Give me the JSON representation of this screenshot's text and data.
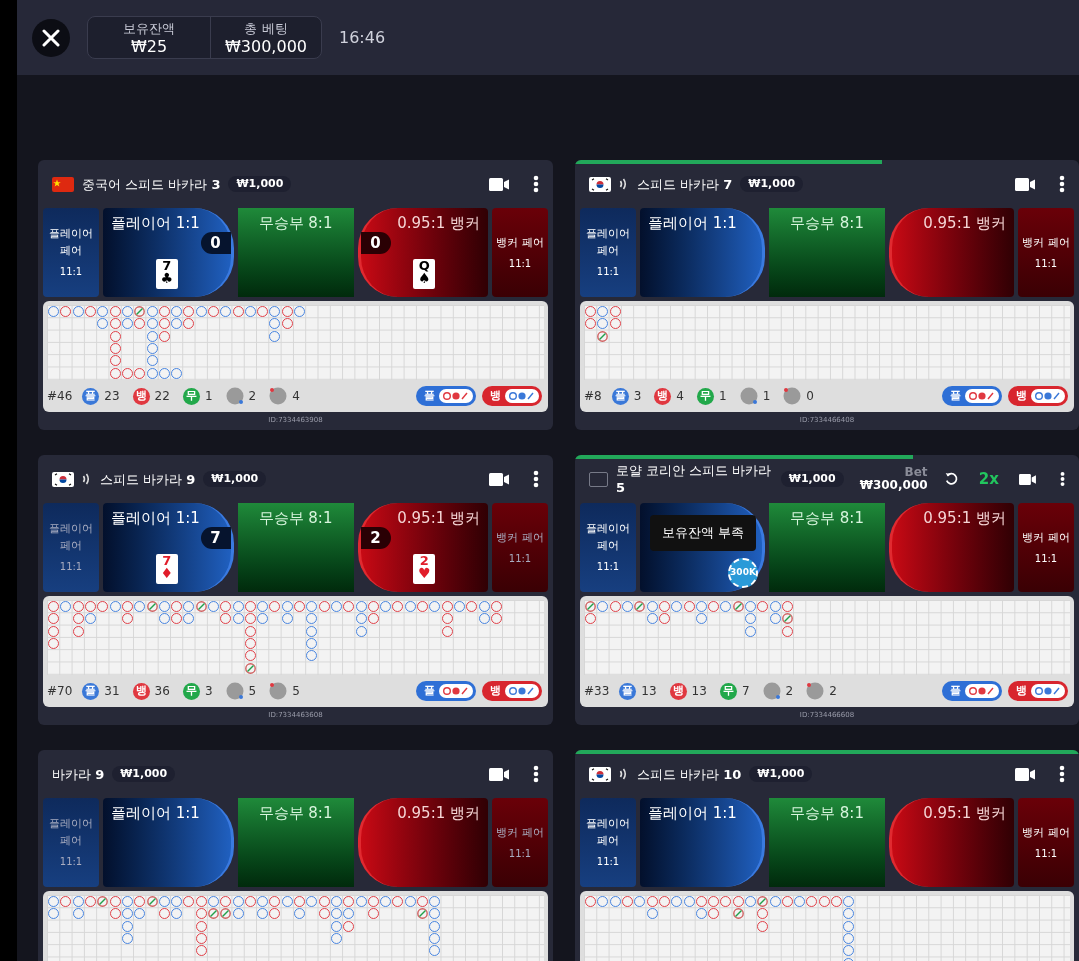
{
  "topbar": {
    "balance": {
      "label": "보유잔액",
      "value": "₩25"
    },
    "total_bet": {
      "label": "총 베팅",
      "value": "₩300,000"
    },
    "time": "16:46"
  },
  "table_rows": [
    [
      {
        "flag": {
          "kind": "china"
        },
        "audio": false,
        "title": "중국어 스피드 바카라 **3**",
        "min_bet": "₩1,000",
        "bets": {
          "player_pair": {
            "label": "플레이어 페어",
            "odds": "11:1",
            "dimmed": false
          },
          "player": {
            "label": "플레이어 1:1",
            "score": "0",
            "card": {
              "rank": "7",
              "suit": "♣",
              "color": "#000000"
            }
          },
          "tie": {
            "label": "무승부 8:1"
          },
          "banker": {
            "label": "0.95:1 뱅커",
            "score": "0",
            "card": {
              "rank": "Q",
              "suit": "♠",
              "color": "#000000"
            }
          },
          "banker_pair": {
            "label": "뱅커 페어",
            "odds": "11:1",
            "dimmed": false
          }
        },
        "road": [
          [
            {
              "kind": "p"
            }
          ],
          [
            {
              "kind": "b"
            }
          ],
          [
            {
              "kind": "p"
            }
          ],
          [
            {
              "kind": "b"
            }
          ],
          [
            {
              "kind": "p"
            },
            {
              "kind": "p"
            }
          ],
          [
            {
              "kind": "b"
            },
            {
              "kind": "b"
            },
            {
              "kind": "b"
            },
            {
              "kind": "b"
            },
            {
              "kind": "b"
            },
            {
              "kind": "b"
            }
          ],
          [
            {
              "kind": "p"
            },
            {
              "kind": "p"
            },
            {
              "kind": "gap"
            },
            {
              "kind": "gap"
            },
            {
              "kind": "gap"
            },
            {
              "kind": "b"
            }
          ],
          [
            {
              "kind": "t"
            },
            {
              "kind": "b"
            },
            {
              "kind": "gap"
            },
            {
              "kind": "gap"
            },
            {
              "kind": "gap"
            },
            {
              "kind": "b"
            }
          ],
          [
            {
              "kind": "p"
            },
            {
              "kind": "p"
            },
            {
              "kind": "p"
            },
            {
              "kind": "p"
            },
            {
              "kind": "p"
            },
            {
              "kind": "p"
            }
          ],
          [
            {
              "kind": "b"
            },
            {
              "kind": "b"
            },
            {
              "kind": "b"
            },
            {
              "kind": "gap"
            },
            {
              "kind": "gap"
            },
            {
              "kind": "p"
            }
          ],
          [
            {
              "kind": "p"
            },
            {
              "kind": "p"
            },
            {
              "kind": "gap"
            },
            {
              "kind": "gap"
            },
            {
              "kind": "gap"
            },
            {
              "kind": "p"
            }
          ],
          [
            {
              "kind": "b"
            },
            {
              "kind": "b"
            }
          ],
          [
            {
              "kind": "p"
            }
          ],
          [
            {
              "kind": "b"
            }
          ],
          [
            {
              "kind": "p"
            }
          ],
          [
            {
              "kind": "b"
            }
          ],
          [
            {
              "kind": "p"
            }
          ],
          [
            {
              "kind": "b"
            }
          ],
          [
            {
              "kind": "p"
            },
            {
              "kind": "p"
            },
            {
              "kind": "p"
            }
          ],
          [
            {
              "kind": "b"
            },
            {
              "kind": "b"
            }
          ],
          [
            {
              "kind": "p"
            }
          ]
        ],
        "stats": {
          "round": "#46",
          "items": [
            {
              "kind": "player",
              "badge": "플",
              "count": "23"
            },
            {
              "kind": "banker",
              "badge": "뱅",
              "count": "22"
            },
            {
              "kind": "tie",
              "badge": "무",
              "count": "1"
            },
            {
              "kind": "player_pair",
              "count": "2"
            },
            {
              "kind": "banker_pair",
              "count": "4"
            }
          ]
        },
        "toggles": [
          {
            "kind": "player",
            "label": "플"
          },
          {
            "kind": "banker",
            "label": "뱅"
          }
        ],
        "id": "ID:7334463908"
      },
      {
        "flag": {
          "kind": "korea"
        },
        "audio": true,
        "timer": {
          "level": 0.61
        },
        "title": "스피드 바카라 **7**",
        "min_bet": "₩1,000",
        "bets": {
          "player_pair": {
            "label": "플레이어 페어",
            "odds": "11:1",
            "dimmed": false
          },
          "player": {
            "label": "플레이어 1:1"
          },
          "tie": {
            "label": "무승부 8:1"
          },
          "banker": {
            "label": "0.95:1 뱅커"
          },
          "banker_pair": {
            "label": "뱅커 페어",
            "odds": "11:1",
            "dimmed": false
          }
        },
        "road": [
          [
            {
              "kind": "b"
            },
            {
              "kind": "b"
            }
          ],
          [
            {
              "kind": "p"
            },
            {
              "kind": "p"
            },
            {
              "kind": "t"
            }
          ],
          [
            {
              "kind": "b"
            },
            {
              "kind": "b"
            }
          ]
        ],
        "stats": {
          "round": "#8",
          "items": [
            {
              "kind": "player",
              "badge": "플",
              "count": "3"
            },
            {
              "kind": "banker",
              "badge": "뱅",
              "count": "4"
            },
            {
              "kind": "tie",
              "badge": "무",
              "count": "1"
            },
            {
              "kind": "player_pair",
              "count": "1"
            },
            {
              "kind": "banker_pair",
              "count": "0"
            }
          ]
        },
        "toggles": [
          {
            "kind": "player",
            "label": "플"
          },
          {
            "kind": "banker",
            "label": "뱅"
          }
        ],
        "id": "ID:7334466408"
      }
    ],
    [
      {
        "flag": {
          "kind": "korea"
        },
        "audio": true,
        "title": "스피드 바카라 **9**",
        "min_bet": "₩1,000",
        "bets": {
          "player_pair": {
            "label": "플레이어 페어",
            "odds": "11:1",
            "dimmed": true
          },
          "player": {
            "label": "플레이어 1:1",
            "score": "7",
            "card": {
              "rank": "7",
              "suit": "♦",
              "color": "#e11d2a"
            }
          },
          "tie": {
            "label": "무승부 8:1"
          },
          "banker": {
            "label": "0.95:1 뱅커",
            "score": "2",
            "card": {
              "rank": "2",
              "suit": "♥",
              "color": "#e11d2a"
            }
          },
          "banker_pair": {
            "label": "뱅커 페어",
            "odds": "11:1",
            "dimmed": true
          }
        },
        "road": [
          [
            {
              "kind": "b"
            },
            {
              "kind": "b"
            },
            {
              "kind": "b"
            },
            {
              "kind": "b"
            }
          ],
          [
            {
              "kind": "p"
            }
          ],
          [
            {
              "kind": "b"
            },
            {
              "kind": "b"
            },
            {
              "kind": "b"
            }
          ],
          [
            {
              "kind": "b"
            },
            {
              "kind": "p"
            }
          ],
          [
            {
              "kind": "b"
            }
          ],
          [
            {
              "kind": "p"
            }
          ],
          [
            {
              "kind": "b"
            },
            {
              "kind": "b"
            }
          ],
          [
            {
              "kind": "p"
            }
          ],
          [
            {
              "kind": "t"
            }
          ],
          [
            {
              "kind": "p"
            },
            {
              "kind": "p"
            }
          ],
          [
            {
              "kind": "b"
            },
            {
              "kind": "b"
            }
          ],
          [
            {
              "kind": "p"
            },
            {
              "kind": "p"
            }
          ],
          [
            {
              "kind": "t"
            }
          ],
          [
            {
              "kind": "p"
            }
          ],
          [
            {
              "kind": "b"
            },
            {
              "kind": "b"
            }
          ],
          [
            {
              "kind": "p"
            },
            {
              "kind": "p"
            }
          ],
          [
            {
              "kind": "b"
            },
            {
              "kind": "b"
            },
            {
              "kind": "b"
            },
            {
              "kind": "b"
            },
            {
              "kind": "b"
            },
            {
              "kind": "t"
            }
          ],
          [
            {
              "kind": "p"
            },
            {
              "kind": "p"
            }
          ],
          [
            {
              "kind": "b"
            }
          ],
          [
            {
              "kind": "p"
            },
            {
              "kind": "p"
            }
          ],
          [
            {
              "kind": "b"
            }
          ],
          [
            {
              "kind": "p"
            },
            {
              "kind": "p"
            },
            {
              "kind": "p"
            },
            {
              "kind": "p"
            },
            {
              "kind": "p"
            }
          ],
          [
            {
              "kind": "b"
            }
          ],
          [
            {
              "kind": "p"
            }
          ],
          [
            {
              "kind": "b"
            }
          ],
          [
            {
              "kind": "p"
            },
            {
              "kind": "p"
            },
            {
              "kind": "p"
            }
          ],
          [
            {
              "kind": "b"
            },
            {
              "kind": "b"
            }
          ],
          [
            {
              "kind": "p"
            }
          ],
          [
            {
              "kind": "b"
            }
          ],
          [
            {
              "kind": "p"
            }
          ],
          [
            {
              "kind": "b"
            }
          ],
          [
            {
              "kind": "p"
            }
          ],
          [
            {
              "kind": "b"
            },
            {
              "kind": "b"
            },
            {
              "kind": "b"
            }
          ],
          [
            {
              "kind": "p"
            }
          ],
          [
            {
              "kind": "b"
            }
          ],
          [
            {
              "kind": "p"
            },
            {
              "kind": "p"
            }
          ],
          [
            {
              "kind": "b"
            },
            {
              "kind": "b"
            }
          ]
        ],
        "stats": {
          "round": "#70",
          "items": [
            {
              "kind": "player",
              "badge": "플",
              "count": "31"
            },
            {
              "kind": "banker",
              "badge": "뱅",
              "count": "36"
            },
            {
              "kind": "tie",
              "badge": "무",
              "count": "3"
            },
            {
              "kind": "player_pair",
              "count": "5"
            },
            {
              "kind": "banker_pair",
              "count": "5"
            }
          ]
        },
        "toggles": [
          {
            "kind": "player",
            "label": "플"
          },
          {
            "kind": "banker",
            "label": "뱅"
          }
        ],
        "id": "ID:7334463608"
      },
      {
        "flag": {
          "kind": "blank"
        },
        "audio": false,
        "timer": {
          "level": 0.67
        },
        "title": "로얄 코리안 스피드 바카라 **5**",
        "min_bet": "₩1,000",
        "bet": {
          "label": "Bet",
          "amount": "₩300,000"
        },
        "multiplier": "2x",
        "bets": {
          "player_pair": {
            "label": "플레이어 페어",
            "odds": "11:1",
            "dimmed": false
          },
          "player": {
            "tooltip": "보유잔액 부족",
            "chip": "300K"
          },
          "tie": {
            "label": "무승부 8:1"
          },
          "banker": {
            "label": "0.95:1 뱅커"
          },
          "banker_pair": {
            "label": "뱅커 페어",
            "odds": "11:1",
            "dimmed": false
          }
        },
        "road": [
          [
            {
              "kind": "t"
            },
            {
              "kind": "b"
            }
          ],
          [
            {
              "kind": "p"
            }
          ],
          [
            {
              "kind": "b"
            }
          ],
          [
            {
              "kind": "p"
            }
          ],
          [
            {
              "kind": "t"
            }
          ],
          [
            {
              "kind": "p"
            },
            {
              "kind": "p"
            }
          ],
          [
            {
              "kind": "b"
            },
            {
              "kind": "b"
            }
          ],
          [
            {
              "kind": "p"
            }
          ],
          [
            {
              "kind": "b"
            }
          ],
          [
            {
              "kind": "p"
            },
            {
              "kind": "p"
            }
          ],
          [
            {
              "kind": "b"
            }
          ],
          [
            {
              "kind": "p"
            }
          ],
          [
            {
              "kind": "t"
            }
          ],
          [
            {
              "kind": "p"
            },
            {
              "kind": "p"
            },
            {
              "kind": "p"
            }
          ],
          [
            {
              "kind": "b"
            }
          ],
          [
            {
              "kind": "p"
            },
            {
              "kind": "p"
            }
          ],
          [
            {
              "kind": "b"
            },
            {
              "kind": "t"
            },
            {
              "kind": "b"
            }
          ]
        ],
        "stats": {
          "round": "#33",
          "items": [
            {
              "kind": "player",
              "badge": "플",
              "count": "13"
            },
            {
              "kind": "banker",
              "badge": "뱅",
              "count": "13"
            },
            {
              "kind": "tie",
              "badge": "무",
              "count": "7"
            },
            {
              "kind": "player_pair",
              "count": "2"
            },
            {
              "kind": "banker_pair",
              "count": "2"
            }
          ]
        },
        "toggles": [
          {
            "kind": "player",
            "label": "플"
          },
          {
            "kind": "banker",
            "label": "뱅"
          }
        ],
        "id": "ID:7334466608"
      }
    ],
    [
      {
        "audio": false,
        "title": "바카라 **9**",
        "min_bet": "₩1,000",
        "bets": {
          "player_pair": {
            "label": "플레이어 페어",
            "odds": "11:1",
            "dimmed": true
          },
          "player": {
            "label": "플레이어 1:1"
          },
          "tie": {
            "label": "무승부 8:1"
          },
          "banker": {
            "label": "0.95:1 뱅커"
          },
          "banker_pair": {
            "label": "뱅커 페어",
            "odds": "11:1",
            "dimmed": true
          }
        },
        "road": [
          [
            {
              "kind": "p"
            },
            {
              "kind": "p"
            }
          ],
          [
            {
              "kind": "b"
            }
          ],
          [
            {
              "kind": "p"
            },
            {
              "kind": "p"
            }
          ],
          [
            {
              "kind": "b"
            }
          ],
          [
            {
              "kind": "t"
            }
          ],
          [
            {
              "kind": "b"
            },
            {
              "kind": "b"
            }
          ],
          [
            {
              "kind": "p"
            },
            {
              "kind": "p"
            },
            {
              "kind": "p"
            },
            {
              "kind": "p"
            }
          ],
          [
            {
              "kind": "b"
            },
            {
              "kind": "p"
            }
          ],
          [
            {
              "kind": "t"
            }
          ],
          [
            {
              "kind": "p"
            },
            {
              "kind": "b"
            }
          ],
          [
            {
              "kind": "p"
            },
            {
              "kind": "p"
            }
          ],
          [
            {
              "kind": "b"
            }
          ],
          [
            {
              "kind": "b"
            },
            {
              "kind": "b"
            },
            {
              "kind": "b"
            },
            {
              "kind": "b"
            },
            {
              "kind": "b"
            }
          ],
          [
            {
              "kind": "p"
            },
            {
              "kind": "t"
            }
          ],
          [
            {
              "kind": "b"
            },
            {
              "kind": "t"
            }
          ],
          [
            {
              "kind": "p"
            },
            {
              "kind": "p"
            }
          ],
          [
            {
              "kind": "b"
            }
          ],
          [
            {
              "kind": "p"
            },
            {
              "kind": "p"
            }
          ],
          [
            {
              "kind": "b"
            },
            {
              "kind": "b"
            }
          ],
          [
            {
              "kind": "p"
            }
          ],
          [
            {
              "kind": "b"
            },
            {
              "kind": "p"
            }
          ],
          [
            {
              "kind": "p"
            }
          ],
          [
            {
              "kind": "b"
            },
            {
              "kind": "b"
            }
          ],
          [
            {
              "kind": "p"
            },
            {
              "kind": "p"
            },
            {
              "kind": "p"
            },
            {
              "kind": "p"
            }
          ],
          [
            {
              "kind": "b"
            },
            {
              "kind": "p"
            },
            {
              "kind": "b"
            }
          ],
          [
            {
              "kind": "p"
            }
          ],
          [
            {
              "kind": "b"
            },
            {
              "kind": "b"
            }
          ],
          [
            {
              "kind": "p"
            }
          ],
          [
            {
              "kind": "b"
            }
          ],
          [
            {
              "kind": "p"
            }
          ],
          [
            {
              "kind": "b"
            },
            {
              "kind": "t"
            }
          ],
          [
            {
              "kind": "p"
            },
            {
              "kind": "p"
            },
            {
              "kind": "p"
            },
            {
              "kind": "p"
            },
            {
              "kind": "p"
            }
          ]
        ]
      },
      {
        "flag": {
          "kind": "korea"
        },
        "audio": true,
        "timer": {
          "level": 1
        },
        "title": "스피드 바카라 **10**",
        "min_bet": "₩1,000",
        "bets": {
          "player_pair": {
            "label": "플레이어 페어",
            "odds": "11:1",
            "dimmed": false
          },
          "player": {
            "label": "플레이어 1:1"
          },
          "tie": {
            "label": "무승부 8:1"
          },
          "banker": {
            "label": "0.95:1 뱅커"
          },
          "banker_pair": {
            "label": "뱅커 페어",
            "odds": "11:1",
            "dimmed": false
          }
        },
        "road": [
          [
            {
              "kind": "b"
            }
          ],
          [
            {
              "kind": "p"
            }
          ],
          [
            {
              "kind": "p"
            }
          ],
          [
            {
              "kind": "b"
            }
          ],
          [
            {
              "kind": "p"
            }
          ],
          [
            {
              "kind": "b"
            },
            {
              "kind": "p"
            }
          ],
          [
            {
              "kind": "b"
            }
          ],
          [
            {
              "kind": "p"
            }
          ],
          [
            {
              "kind": "p"
            }
          ],
          [
            {
              "kind": "b"
            },
            {
              "kind": "p"
            }
          ],
          [
            {
              "kind": "b"
            },
            {
              "kind": "b"
            }
          ],
          [
            {
              "kind": "b"
            }
          ],
          [
            {
              "kind": "b"
            },
            {
              "kind": "t"
            }
          ],
          [
            {
              "kind": "p"
            }
          ],
          [
            {
              "kind": "t"
            },
            {
              "kind": "b"
            },
            {
              "kind": "b"
            }
          ],
          [
            {
              "kind": "p"
            }
          ],
          [
            {
              "kind": "b"
            }
          ],
          [
            {
              "kind": "p"
            }
          ],
          [
            {
              "kind": "b"
            }
          ],
          [
            {
              "kind": "b"
            }
          ],
          [
            {
              "kind": "b"
            }
          ],
          [
            {
              "kind": "p"
            },
            {
              "kind": "p"
            },
            {
              "kind": "p"
            },
            {
              "kind": "p"
            },
            {
              "kind": "p"
            },
            {
              "kind": "p"
            }
          ]
        ]
      }
    ]
  ]
}
